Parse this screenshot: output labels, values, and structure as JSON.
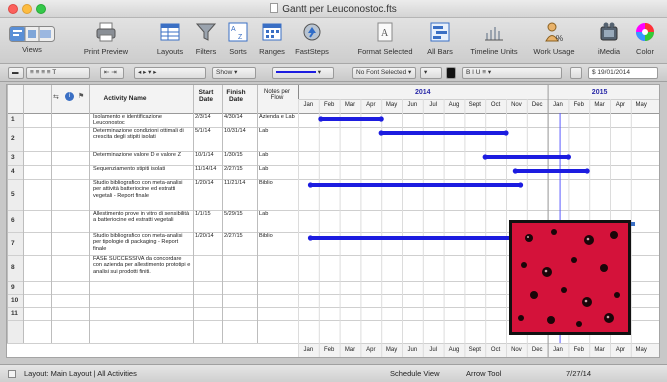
{
  "window": {
    "title": "Gantt per Leuconostoc.fts"
  },
  "toolbar": {
    "views": "Views",
    "print_preview": "Print Preview",
    "layouts": "Layouts",
    "filters": "Filters",
    "sorts": "Sorts",
    "ranges": "Ranges",
    "faststeps": "FastSteps",
    "format_selected": "Format Selected",
    "all_bars": "All Bars",
    "timeline_units": "Timeline Units",
    "work_usage": "Work Usage",
    "imedia": "iMedia",
    "color": "Color"
  },
  "formatbar": {
    "show": "Show",
    "no_font": "No Font Selected",
    "date": "19/01/2014"
  },
  "table": {
    "headers": {
      "activity": "Activity Name",
      "start": "Start Date",
      "finish": "Finish Date",
      "notes": "Notes per Flow"
    },
    "rows": [
      {
        "n": "1",
        "activity": "Isolamento e identificazione Leuconostoc",
        "start": "2/3/14",
        "finish": "4/30/14",
        "notes": "Azienda e Lab"
      },
      {
        "n": "2",
        "activity": "Determinazione condizioni ottimali di crescita degli stipiti isolati",
        "start": "5/1/14",
        "finish": "10/31/14",
        "notes": "Lab"
      },
      {
        "n": "3",
        "activity": "Determinazione valore D e valore Z",
        "start": "10/1/14",
        "finish": "1/30/15",
        "notes": "Lab"
      },
      {
        "n": "4",
        "activity": "Sequenziamento stipiti isolati",
        "start": "11/14/14",
        "finish": "2/27/15",
        "notes": "Lab"
      },
      {
        "n": "5",
        "activity": "Studio bibliografico con meta-analisi per attività batteriocine ed estratti vegetali - Report finale",
        "start": "1/20/14",
        "finish": "11/21/14",
        "notes": "Biblio"
      },
      {
        "n": "6",
        "activity": "Allestimento prove in vitro di sensibilità a batteriocine ed estratti vegetali",
        "start": "1/1/15",
        "finish": "5/29/15",
        "notes": "Lab"
      },
      {
        "n": "7",
        "activity": "Studio bibliografico con meta-analisi per tipologie di packaging - Report finale",
        "start": "1/20/14",
        "finish": "2/27/15",
        "notes": "Biblio"
      },
      {
        "n": "8",
        "activity": "FASE SUCCESSIVA da concordare con azienda per allestimento prototipi e analisi sui prodotti finiti.",
        "start": "",
        "finish": "",
        "notes": ""
      },
      {
        "n": "9",
        "activity": "",
        "start": "",
        "finish": "",
        "notes": ""
      },
      {
        "n": "10",
        "activity": "",
        "start": "",
        "finish": "",
        "notes": ""
      },
      {
        "n": "11",
        "activity": "",
        "start": "",
        "finish": "",
        "notes": ""
      }
    ]
  },
  "timeline": {
    "years": [
      "2014",
      "2015"
    ],
    "months": [
      "Jan",
      "Feb",
      "Mar",
      "Apr",
      "May",
      "Jun",
      "Jul",
      "Aug",
      "Sept",
      "Oct",
      "Nov",
      "Dec",
      "Jan",
      "Feb",
      "Mar",
      "Apr",
      "May"
    ],
    "bars": [
      {
        "row": 1,
        "start_month": 1.1,
        "end_month": 4.0
      },
      {
        "row": 2,
        "start_month": 4.0,
        "end_month": 10.0
      },
      {
        "row": 3,
        "start_month": 9.0,
        "end_month": 13.0
      },
      {
        "row": 4,
        "start_month": 10.45,
        "end_month": 13.9
      },
      {
        "row": 5,
        "start_month": 0.6,
        "end_month": 10.7
      },
      {
        "row": 7,
        "start_month": 0.6,
        "end_month": 13.9
      }
    ],
    "today_month": 12.6,
    "bar_color": "#1c1ce0"
  },
  "statusbar": {
    "layout": "Layout: Main Layout | All Activities",
    "schedule_view": "Schedule View",
    "arrow_tool": "Arrow Tool",
    "date": "7/27/14"
  }
}
